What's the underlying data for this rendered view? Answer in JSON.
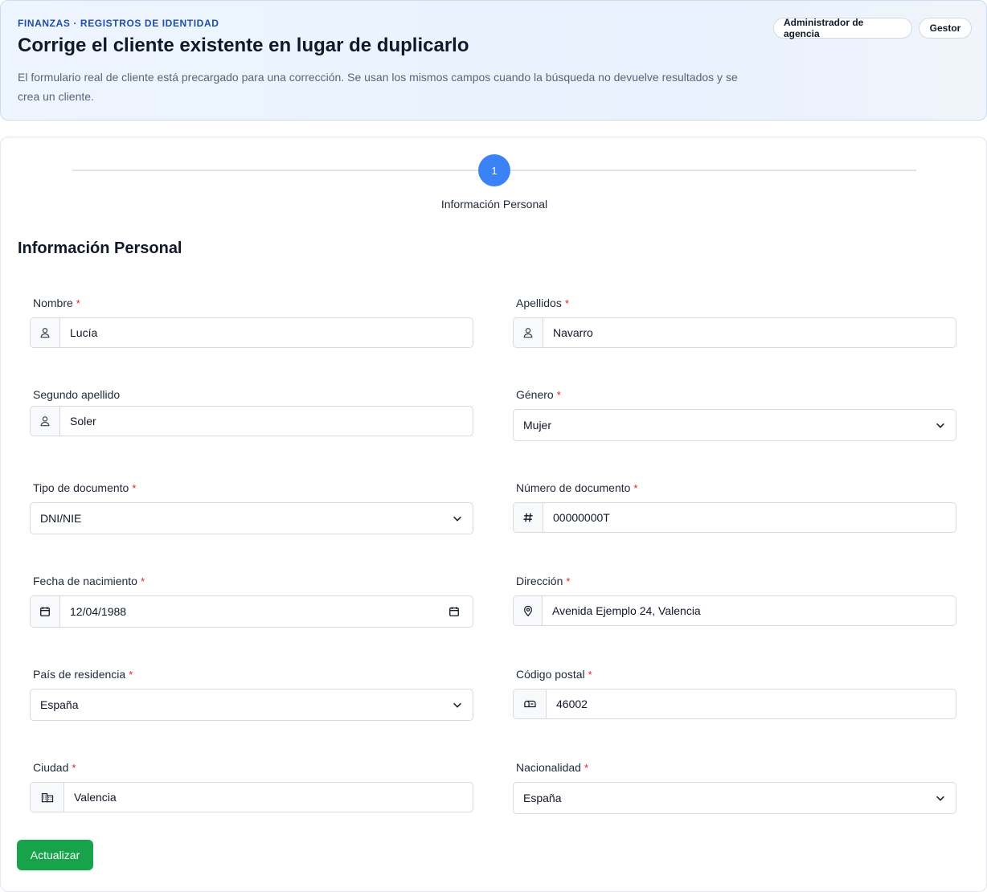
{
  "header": {
    "eyebrow": "FINANZAS · REGISTROS DE IDENTIDAD",
    "title": "Corrige el cliente existente en lugar de duplicarlo",
    "description": "El formulario real de cliente está precargado para una corrección. Se usan los mismos campos cuando la búsqueda no devuelve resultados y se crea un cliente.",
    "roles": [
      "Administrador de agencia",
      "Gestor"
    ]
  },
  "stepper": {
    "number": "1",
    "label": "Información Personal"
  },
  "section_title": "Información Personal",
  "required_mark": "*",
  "fields": {
    "nombre": {
      "label": "Nombre",
      "value": "Lucía",
      "icon": "person-icon"
    },
    "apellidos": {
      "label": "Apellidos",
      "value": "Navarro",
      "icon": "person-icon"
    },
    "segundo_apellido": {
      "label": "Segundo apellido",
      "value": "Soler",
      "icon": "person-icon"
    },
    "genero": {
      "label": "Género",
      "value": "Mujer"
    },
    "tipo_documento": {
      "label": "Tipo de documento",
      "value": "DNI/NIE"
    },
    "numero_documento": {
      "label": "Número de documento",
      "value": "00000000T",
      "icon": "hash-icon"
    },
    "fecha_nacimiento": {
      "label": "Fecha de nacimiento",
      "value": "12/04/1988",
      "icon": "calendar-icon"
    },
    "direccion": {
      "label": "Dirección",
      "value": "Avenida Ejemplo 24, Valencia",
      "icon": "location-pin-icon"
    },
    "pais_residencia": {
      "label": "País de residencia",
      "value": "España"
    },
    "codigo_postal": {
      "label": "Código postal",
      "value": "46002",
      "icon": "mailbox-icon"
    },
    "ciudad": {
      "label": "Ciudad",
      "value": "Valencia",
      "icon": "city-icon"
    },
    "nacionalidad": {
      "label": "Nacionalidad",
      "value": "España"
    }
  },
  "submit_label": "Actualizar",
  "colors": {
    "accent": "#3b82f6",
    "submit": "#16a34a",
    "required": "#dc2626",
    "eyebrow": "#1e4fa3"
  }
}
